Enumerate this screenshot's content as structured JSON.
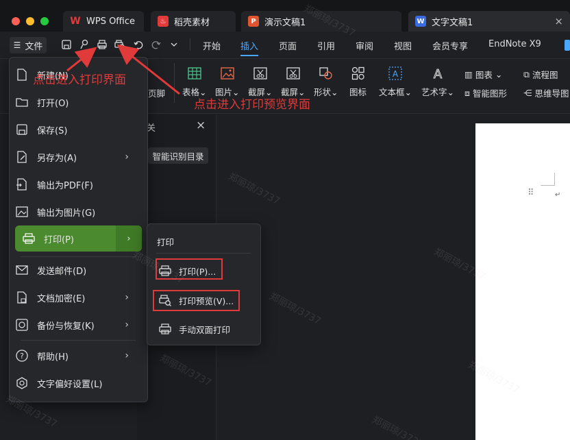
{
  "tabs": [
    {
      "label": "WPS Office",
      "icon": "wps-logo-icon",
      "color": "#e23b3b"
    },
    {
      "label": "稻壳素材",
      "icon": "docer-logo-icon",
      "color": "#e23b3b"
    },
    {
      "label": "演示文稿1",
      "icon": "presentation-icon",
      "color": "#e0542f",
      "glyph": "P"
    },
    {
      "label": "文字文稿1",
      "icon": "word-doc-icon",
      "color": "#3a6be0",
      "glyph": "W"
    }
  ],
  "file_button": "文件",
  "menu": [
    "开始",
    "插入",
    "页面",
    "引用",
    "审阅",
    "视图",
    "会员专享",
    "EndNote X9"
  ],
  "active_menu": "插入",
  "toolbar": [
    {
      "label": "表格",
      "icon": "table-icon"
    },
    {
      "label": "图片",
      "icon": "picture-icon"
    },
    {
      "label": "截屏",
      "icon": "screenshot-icon"
    },
    {
      "label": "截屏",
      "icon": "screenshot-icon"
    },
    {
      "label": "形状",
      "icon": "shape-icon"
    },
    {
      "label": "图标",
      "icon": "icon-library-icon"
    },
    {
      "label": "文本框",
      "icon": "textbox-icon"
    },
    {
      "label": "艺术字",
      "icon": "wordart-icon"
    }
  ],
  "toolbar_right": {
    "chart": "图表",
    "flowchart": "流程图",
    "smart_graphic": "智能图形",
    "mindmap": "思维导图",
    "footer_fragment": "页脚"
  },
  "panel": {
    "smart_toc": "智能识别目录",
    "fragment": "关"
  },
  "file_menu": [
    {
      "label": "新建(N)",
      "icon": "new-document-icon"
    },
    {
      "label": "打开(O)",
      "icon": "open-folder-icon"
    },
    {
      "label": "保存(S)",
      "icon": "save-icon"
    },
    {
      "label": "另存为(A)",
      "icon": "save-as-icon",
      "arrow": true
    },
    {
      "label": "输出为PDF(F)",
      "icon": "export-pdf-icon"
    },
    {
      "label": "输出为图片(G)",
      "icon": "export-image-icon"
    },
    {
      "label": "打印(P)",
      "icon": "printer-icon",
      "arrow": true,
      "selected": true
    },
    {
      "label": "发送邮件(D)",
      "icon": "mail-icon"
    },
    {
      "label": "文档加密(E)",
      "icon": "lock-document-icon",
      "arrow": true
    },
    {
      "label": "备份与恢复(K)",
      "icon": "backup-icon",
      "arrow": true
    },
    {
      "label": "帮助(H)",
      "icon": "help-icon",
      "arrow": true
    },
    {
      "label": "文字偏好设置(L)",
      "icon": "settings-hex-icon"
    }
  ],
  "print_submenu": {
    "title": "打印",
    "items": [
      {
        "label": "打印(P)...",
        "icon": "printer-icon"
      },
      {
        "label": "打印预览(V)...",
        "icon": "print-preview-icon"
      },
      {
        "label": "手动双面打印",
        "icon": "duplex-print-icon"
      }
    ]
  },
  "annotations": {
    "print": "点击进入打印界面",
    "preview": "点击进入打印预览界面",
    "color": "#e03a3a"
  },
  "watermark": "郑丽琼/3737"
}
